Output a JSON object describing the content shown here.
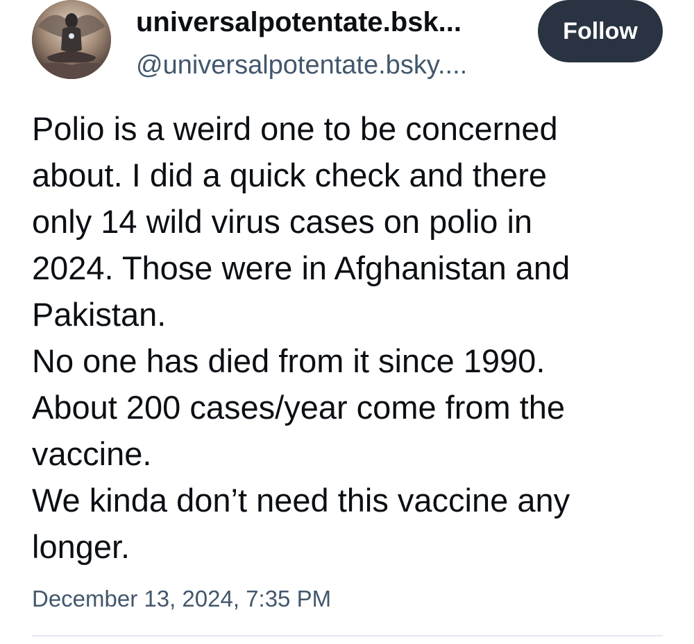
{
  "post": {
    "author": {
      "display_name": "universalpotentate.bsk...",
      "handle": "@universalpotentate.bsky...."
    },
    "follow_label": "Follow",
    "body_lines": [
      "Polio is a weird one to be concerned",
      "about. I did a quick check and there",
      "only 14 wild virus cases on polio in",
      "2024. Those were in Afghanistan and",
      "Pakistan.",
      "No one has died from it since 1990.",
      "About 200 cases/year come from the",
      "vaccine.",
      "We kinda don’t need this vaccine any",
      "longer."
    ],
    "timestamp": "December 13, 2024, 7:35 PM"
  },
  "colors": {
    "follow_button_bg": "#293341",
    "handle_text": "#42576c",
    "divider": "#e3e8ee"
  }
}
